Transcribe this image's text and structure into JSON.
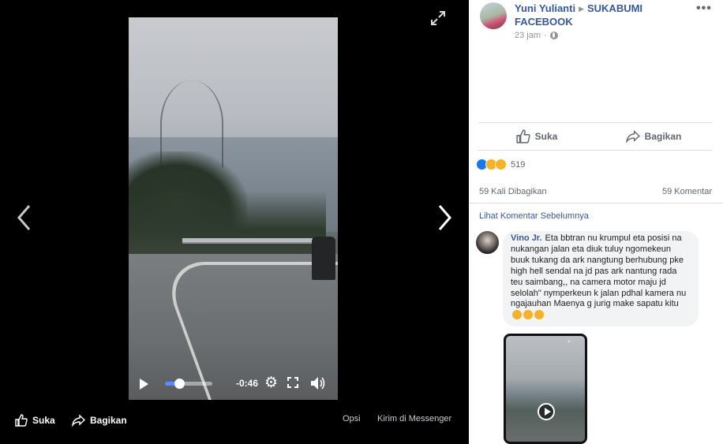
{
  "viewer": {
    "video": {
      "time_remaining": "-0:46",
      "progress": 0.3,
      "controls": {
        "play_icon": "play-icon",
        "settings_icon": "gear-icon",
        "fullscreen_icon": "fullscreen-icon",
        "volume_icon": "volume-icon"
      }
    },
    "bottom_bar": {
      "like_label": "Suka",
      "share_label": "Bagikan",
      "options_label": "Opsi",
      "messenger_label": "Kirim di Messenger"
    }
  },
  "post": {
    "author": "Yuni Yulianti",
    "group": "SUKABUMI FACEBOOK",
    "time": "23 jam",
    "privacy_icon": "globe-icon",
    "actions": {
      "like_label": "Suka",
      "share_label": "Bagikan"
    },
    "reactions": {
      "types": [
        "like",
        "haha",
        "wow"
      ],
      "count": "519"
    },
    "shares": "59 Kali Dibagikan",
    "comments_count": "59 Komentar",
    "previous_comments_link": "Lihat Komentar Sebelumnya",
    "comment": {
      "author": "Vino Jr.",
      "text": "Eta bbtran nu krumpul eta posisi na nukangan jalan eta diuk tuluy ngomekeun buuk tukang da ark nangtung berhubung pke high hell sendal na jd pas ark nantung rada teu saimbang,, na camera motor maju jd selolah\" nymperkeun k jalan pdhal kamera nu ngajauhan Maenya g jurig make sapatu kitu",
      "emojis": [
        "laughing-emoji",
        "laughing-emoji",
        "laughing-emoji"
      ]
    }
  },
  "colors": {
    "link": "#385898",
    "like_blue": "#1877f2",
    "progress_blue": "#4f8ff7"
  }
}
